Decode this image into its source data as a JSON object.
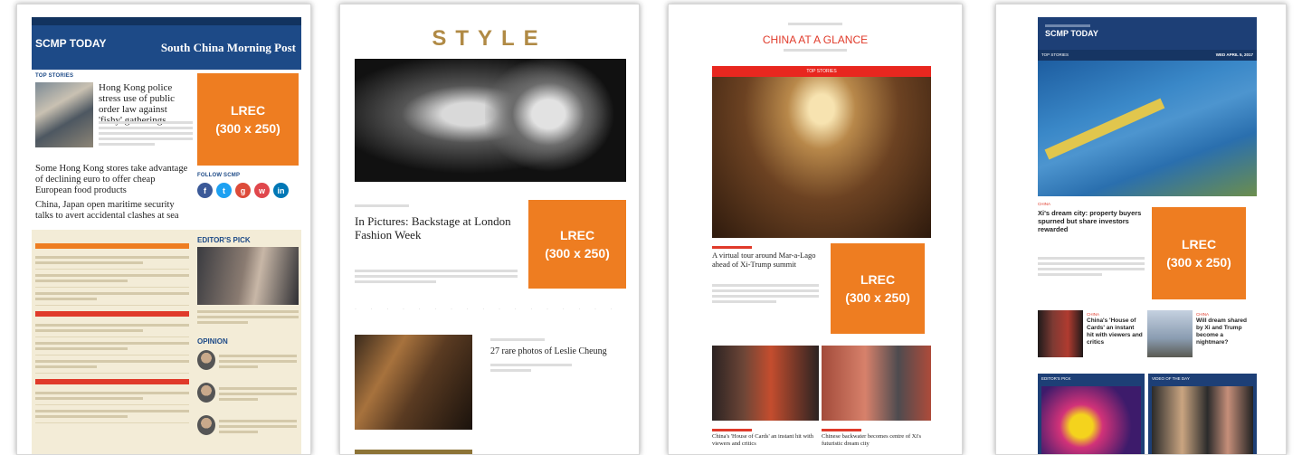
{
  "lrec": {
    "line1": "LREC",
    "line2": "(300 x 250)"
  },
  "card1": {
    "masthead_left": "SCMP TODAY",
    "masthead_right": "South China Morning Post",
    "top_stories": "TOP STORIES",
    "h1": "Hong Kong police stress use of public order law against 'fishy' gatherings",
    "h2": "Some Hong Kong stores take advantage of declining euro to offer cheap European food products",
    "h3": "China, Japan open maritime security talks to avert accidental clashes at sea",
    "follow": "FOLLOW SCMP",
    "editors_pick": "EDITOR'S PICK",
    "opinion": "OPINION"
  },
  "card2": {
    "logo": "STYLE",
    "title": "In Pictures: Backstage at London Fashion Week",
    "title2": "27 rare photos of Leslie Cheung"
  },
  "card3": {
    "title": "CHINA AT A GLANCE",
    "top_stories": "TOP STORIES",
    "story1": "A virtual tour around Mar-a-Lago ahead of Xi-Trump summit",
    "story2": "China's 'House of Cards' an instant hit with viewers and critics",
    "story3": "Chinese backwater becomes centre of Xi's futuristic dream city"
  },
  "card4": {
    "masthead": "SCMP TODAY",
    "top_stories": "TOP STORIES",
    "date": "WED APRIL 5, 2017",
    "story1": "Xi's dream city: property buyers spurned but share investors rewarded",
    "story2": "China's 'House of Cards' an instant hit with viewers and critics",
    "story3": "Will dream shared by Xi and Trump become a nightmare?",
    "kicker": "CHINA",
    "editors_pick": "EDITOR'S PICK",
    "video": "VIDEO OF THE DAY"
  }
}
